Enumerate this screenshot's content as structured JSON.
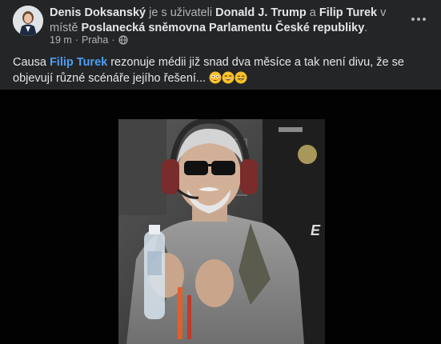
{
  "post": {
    "author": "Denis Doksanský",
    "connector_1": " je s uživateli ",
    "tagged_1": "Donald J. Trump",
    "connector_2": " a ",
    "tagged_2": "Filip Turek",
    "connector_3": " v místě ",
    "location": "Poslanecká sněmovna Parlamentu České republiky",
    "location_suffix": ".",
    "time": "19 m",
    "separator": "·",
    "place": "Praha",
    "separator_2": "·",
    "privacy_icon": "globe-icon",
    "more_icon": "more-options-icon",
    "text_before": "Causa ",
    "text_mention": "Filip Turek",
    "text_after": " rezonuje médii již snad dva měsíce a tak není divu, že se objevují různé scénáře jejího řešení...",
    "emojis": [
      "flushed-face",
      "laughing-face",
      "grinning-face"
    ]
  },
  "colors": {
    "background": "#242526",
    "text": "#e4e6eb",
    "secondary": "#b0b3b8",
    "link": "#4d9ff5"
  }
}
